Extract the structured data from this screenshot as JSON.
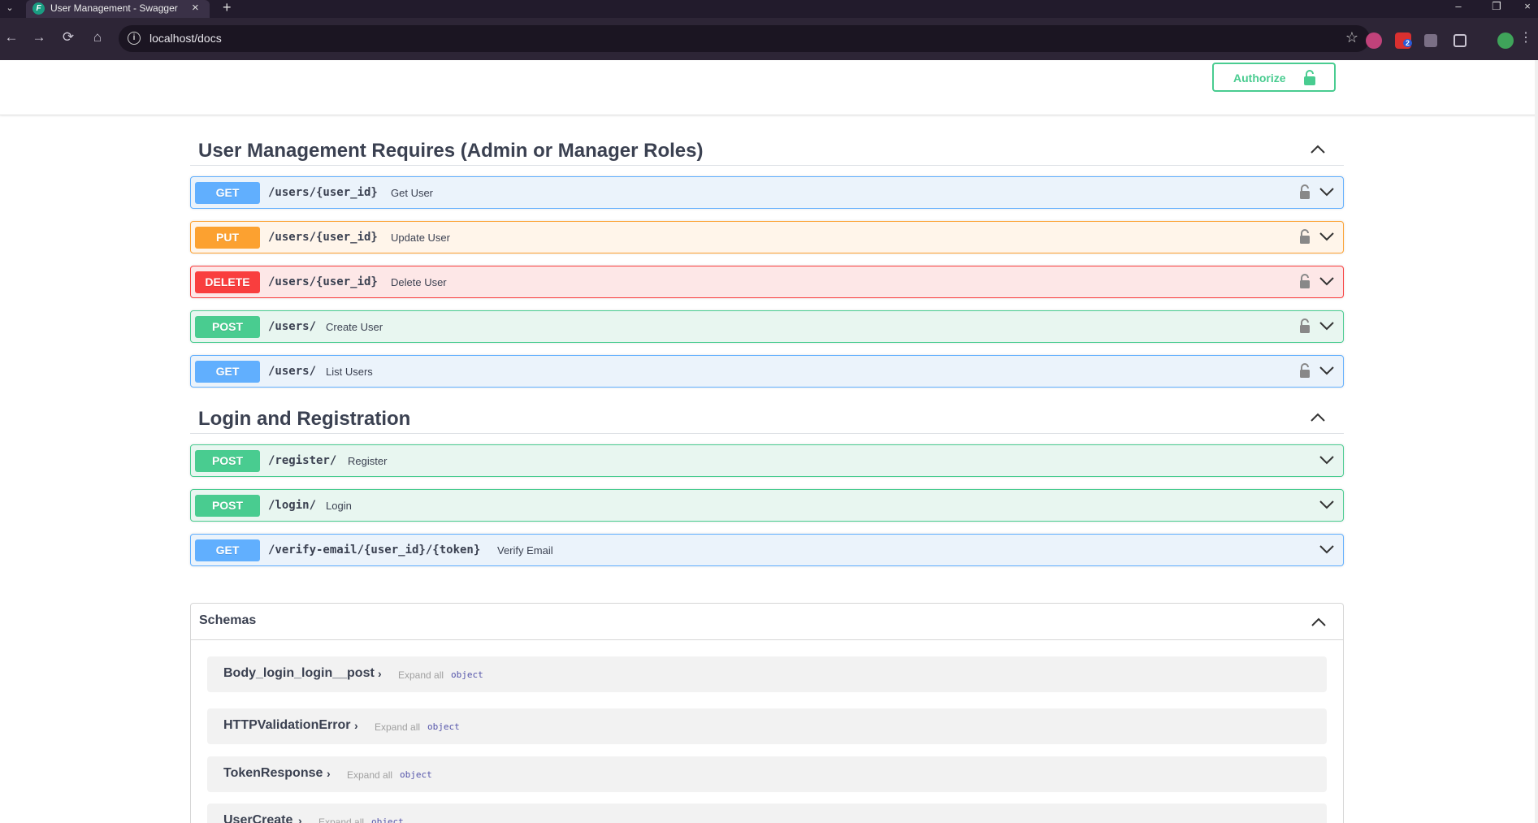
{
  "browser": {
    "tab_title": "User Management - Swagger UI",
    "url": "localhost/docs",
    "extension_badge": "2"
  },
  "auth": {
    "authorize_label": "Authorize"
  },
  "tags": [
    {
      "title": "User Management Requires (Admin or Manager Roles)",
      "operations": [
        {
          "method": "GET",
          "path": "/users/{user_id}",
          "summary": "Get User"
        },
        {
          "method": "PUT",
          "path": "/users/{user_id}",
          "summary": "Update User"
        },
        {
          "method": "DELETE",
          "path": "/users/{user_id}",
          "summary": "Delete User"
        },
        {
          "method": "POST",
          "path": "/users/",
          "summary": "Create User"
        },
        {
          "method": "GET",
          "path": "/users/",
          "summary": "List Users"
        }
      ]
    },
    {
      "title": "Login and Registration",
      "operations": [
        {
          "method": "POST",
          "path": "/register/",
          "summary": "Register"
        },
        {
          "method": "POST",
          "path": "/login/",
          "summary": "Login"
        },
        {
          "method": "GET",
          "path": "/verify-email/{user_id}/{token}",
          "summary": "Verify Email"
        }
      ]
    }
  ],
  "schemas": {
    "title": "Schemas",
    "models": [
      {
        "name": "Body_login_login__post",
        "expand_label": "Expand all",
        "type": "object"
      },
      {
        "name": "HTTPValidationError",
        "expand_label": "Expand all",
        "type": "object"
      },
      {
        "name": "TokenResponse",
        "expand_label": "Expand all",
        "type": "object"
      },
      {
        "name": "UserCreate",
        "expand_label": "Expand all",
        "type": "object"
      }
    ]
  },
  "colors": {
    "get": "#61affe",
    "put": "#fca130",
    "delete": "#f93e3e",
    "post": "#49cc90"
  }
}
